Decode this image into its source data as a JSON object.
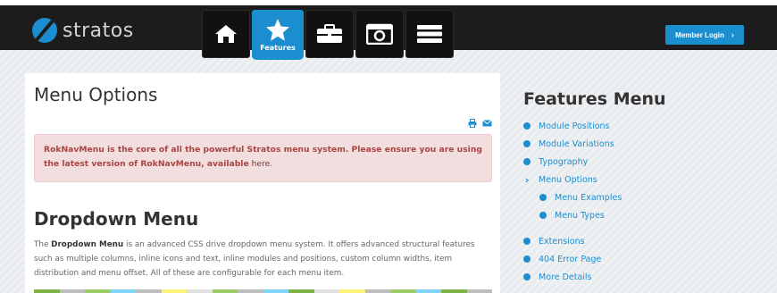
{
  "brand": {
    "name": "stratos"
  },
  "nav": [
    {
      "icon": "home-icon",
      "label": ""
    },
    {
      "icon": "star-icon",
      "label": "Features",
      "active": true
    },
    {
      "icon": "briefcase-icon",
      "label": ""
    },
    {
      "icon": "camera-icon",
      "label": ""
    },
    {
      "icon": "server-icon",
      "label": ""
    }
  ],
  "member_login": {
    "label": "Member Login",
    "chevron": "›"
  },
  "main": {
    "title": "Menu Options",
    "alert": {
      "bold_text": "RokNavMenu is the core of all the powerful Stratos menu system. Please ensure you are using the latest version of RokNavMenu, available",
      "plain_text": " here."
    },
    "section_title": "Dropdown Menu",
    "paragraph": {
      "prefix": "The ",
      "bold": "Dropdown Menu",
      "rest": " is an advanced CSS drive dropdown menu system. It offers advanced structural features such as multiple columns, inline icons and text, inline modules and positions, custom column widths, item distribution and menu offset. All of these are configurable for each menu item."
    }
  },
  "sidebar": {
    "title": "Features Menu",
    "items": [
      {
        "label": "Module Positions",
        "type": "dot"
      },
      {
        "label": "Module Variations",
        "type": "dot"
      },
      {
        "label": "Typography",
        "type": "dot"
      },
      {
        "label": "Menu Options",
        "type": "chevron"
      },
      {
        "label": "Menu Examples",
        "type": "sub"
      },
      {
        "label": "Menu Types",
        "type": "sub"
      },
      {
        "label": "Extensions",
        "type": "dot"
      },
      {
        "label": "404 Error Page",
        "type": "dot"
      },
      {
        "label": "More Details",
        "type": "dot"
      }
    ]
  },
  "colors": {
    "accent": "#1b8ed0",
    "topbar": "#1c1c1c",
    "alert_bg": "#f2dede",
    "alert_text": "#a94442"
  },
  "strip_colors": [
    "#7cb342",
    "#bdbdbd",
    "#9ccc65",
    "#81d4fa",
    "#bdbdbd",
    "#fff176",
    "#e0e0e0",
    "#9ccc65",
    "#bdbdbd",
    "#81d4fa",
    "#7cb342",
    "#e0e0e0",
    "#fff176",
    "#bdbdbd",
    "#9ccc65",
    "#81d4fa",
    "#7cb342",
    "#bdbdbd"
  ]
}
